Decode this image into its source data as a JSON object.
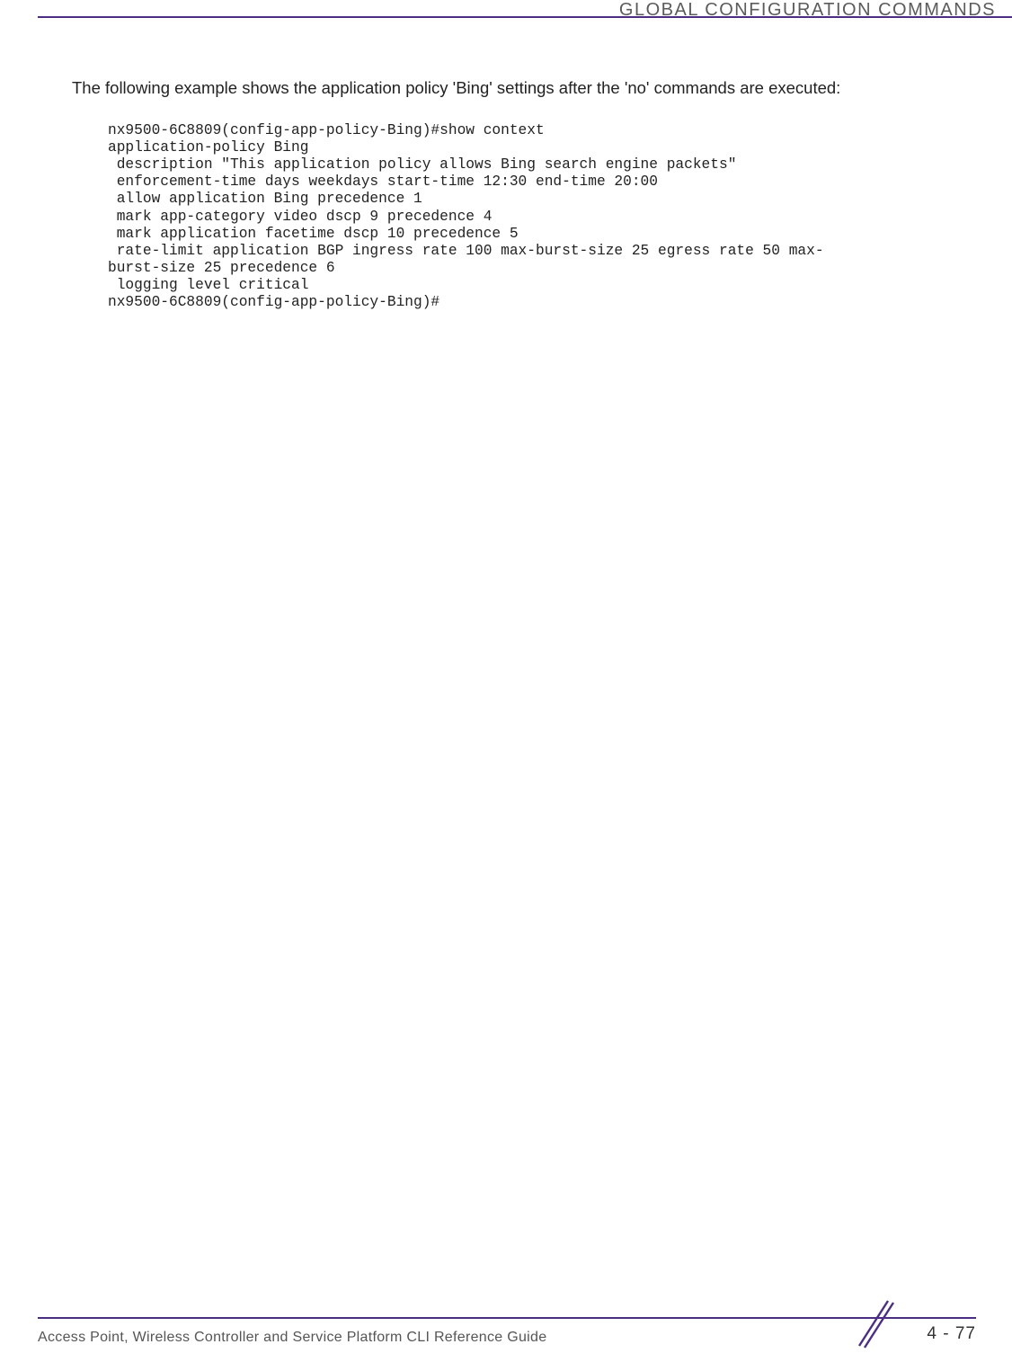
{
  "header": {
    "title": "GLOBAL CONFIGURATION COMMANDS"
  },
  "body": {
    "intro": "The following example shows the application policy 'Bing' settings after the 'no' commands are executed:",
    "code": "nx9500-6C8809(config-app-policy-Bing)#show context\napplication-policy Bing\n description \"This application policy allows Bing search engine packets\"\n enforcement-time days weekdays start-time 12:30 end-time 20:00\n allow application Bing precedence 1\n mark app-category video dscp 9 precedence 4\n mark application facetime dscp 10 precedence 5\n rate-limit application BGP ingress rate 100 max-burst-size 25 egress rate 50 max-\nburst-size 25 precedence 6\n logging level critical\nnx9500-6C8809(config-app-policy-Bing)#"
  },
  "footer": {
    "text": "Access Point, Wireless Controller and Service Platform CLI Reference Guide",
    "page": "4 - 77"
  }
}
